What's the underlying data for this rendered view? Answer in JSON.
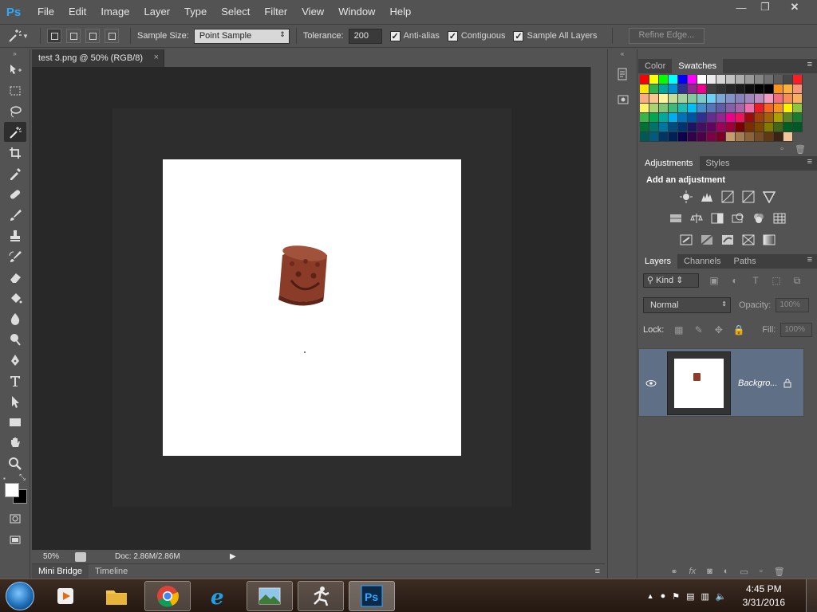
{
  "app": {
    "logo": "Ps",
    "menu": [
      "File",
      "Edit",
      "Image",
      "Layer",
      "Type",
      "Select",
      "Filter",
      "View",
      "Window",
      "Help"
    ],
    "window_controls": {
      "minimize": "—",
      "restore": "❐",
      "close": "✕"
    }
  },
  "options": {
    "sample_size_label": "Sample Size:",
    "sample_size_value": "Point Sample",
    "tolerance_label": "Tolerance:",
    "tolerance_value": "200",
    "anti_alias": "Anti-alias",
    "contiguous": "Contiguous",
    "sample_all_layers": "Sample All Layers",
    "refine_edge": "Refine Edge...",
    "check": "✓"
  },
  "document": {
    "tab_title": "test 3.png @ 50% (RGB/8)",
    "tab_close": "×",
    "zoom": "50%",
    "doc_info": "Doc: 2.86M/2.86M",
    "status_arrow": "▶"
  },
  "bottom_panel": {
    "tabs": [
      "Mini Bridge",
      "Timeline"
    ]
  },
  "panels": {
    "swatches_tabs": [
      "Color",
      "Swatches"
    ],
    "adjustments_tabs": [
      "Adjustments",
      "Styles"
    ],
    "adjustments_heading": "Add an adjustment",
    "layers_tabs": [
      "Layers",
      "Channels",
      "Paths"
    ],
    "kind_label": "Kind",
    "blend_mode": "Normal",
    "opacity_label": "Opacity:",
    "opacity_value": "100%",
    "lock_label": "Lock:",
    "fill_label": "Fill:",
    "fill_value": "100%",
    "layer_name": "Backgro...",
    "menu_glyph": "≡"
  },
  "swatch_colors": [
    "#ff0000",
    "#ffff00",
    "#00ff00",
    "#00ffff",
    "#0000ff",
    "#ff00ff",
    "#ffffff",
    "#ebebeb",
    "#d6d6d6",
    "#c2c2c2",
    "#adadad",
    "#999999",
    "#858585",
    "#707070",
    "#5c5c5c",
    "#474747",
    "#ff1d25",
    "#ffe600",
    "#2fb34a",
    "#00a79d",
    "#0090d4",
    "#2e3192",
    "#92278f",
    "#ec008c",
    "#404040",
    "#333333",
    "#262626",
    "#1a1a1a",
    "#0d0d0d",
    "#000000",
    "#000000",
    "#f7931e",
    "#fbb040",
    "#f7977a",
    "#f9ad81",
    "#fdc68a",
    "#fff79a",
    "#c4df9b",
    "#a3d39c",
    "#82ca9c",
    "#7accc8",
    "#6dcff6",
    "#7da7d9",
    "#8393ca",
    "#8781bd",
    "#a186be",
    "#bd8cbf",
    "#f49ac1",
    "#f26d7d",
    "#f68e56",
    "#fbaf5d",
    "#fff467",
    "#acd372",
    "#7cc576",
    "#3cb878",
    "#1cbbb4",
    "#00bff3",
    "#448ccb",
    "#5574b9",
    "#605ca8",
    "#8560a8",
    "#a864a8",
    "#f06eaa",
    "#ed1c24",
    "#f26522",
    "#f7941d",
    "#fff200",
    "#8dc63f",
    "#39b54a",
    "#00a651",
    "#00a99d",
    "#00aeef",
    "#0072bc",
    "#0054a6",
    "#2e3192",
    "#662d91",
    "#92278f",
    "#ec008c",
    "#ed145b",
    "#9e0b0f",
    "#a0410d",
    "#a3620a",
    "#aba000",
    "#598527",
    "#1a7b30",
    "#007236",
    "#00746b",
    "#0076a3",
    "#004b80",
    "#003471",
    "#1b1464",
    "#440e62",
    "#630460",
    "#9e005d",
    "#9e0039",
    "#790000",
    "#7b2e00",
    "#7d4900",
    "#827b00",
    "#406618",
    "#005e20",
    "#005826",
    "#005952",
    "#005b7f",
    "#003663",
    "#002157",
    "#0d004c",
    "#32004b",
    "#4b0049",
    "#7b0046",
    "#7a0026",
    "#c69c6d",
    "#a67c52",
    "#8c6239",
    "#754c24",
    "#603913",
    "#3c2415",
    "#f4c49b"
  ],
  "taskbar": {
    "time": "4:45 PM",
    "date": "3/31/2016"
  },
  "colors": {
    "accent": "#31a8ff",
    "canvas": "#ffffff",
    "layer_selected": "#5f6f85",
    "cup": "#8e3f2a"
  }
}
